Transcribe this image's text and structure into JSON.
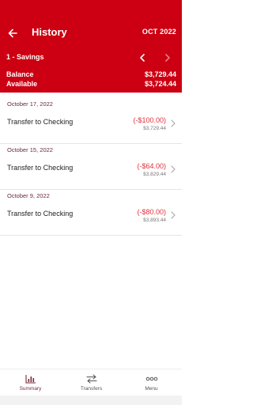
{
  "header": {
    "title": "History",
    "month": "OCT 2022",
    "account": "1 - Savings",
    "balance_label": "Balance",
    "balance_value": "$3,729.44",
    "available_label": "Available",
    "available_value": "$3,724.44"
  },
  "transactions": [
    {
      "date": "October 17, 2022",
      "description": "Transfer to Checking",
      "amount": "(-$100.00)",
      "running_balance": "$3,729.44"
    },
    {
      "date": "October 15, 2022",
      "description": "Transfer to Checking",
      "amount": "(-$64.00)",
      "running_balance": "$3,829.44"
    },
    {
      "date": "October 9, 2022",
      "description": "Transfer to Checking",
      "amount": "(-$80.00)",
      "running_balance": "$3,893.44"
    }
  ],
  "tabs": [
    {
      "label": "Summary",
      "icon": "bar-chart-icon",
      "active": true
    },
    {
      "label": "Transfers",
      "icon": "transfer-arrows-icon",
      "active": false
    },
    {
      "label": "Menu",
      "icon": "more-dots-icon",
      "active": false
    }
  ],
  "colors": {
    "brand_red": "#cc0012",
    "negative_amount": "#e0303c",
    "date_header": "#6b2a3a"
  }
}
